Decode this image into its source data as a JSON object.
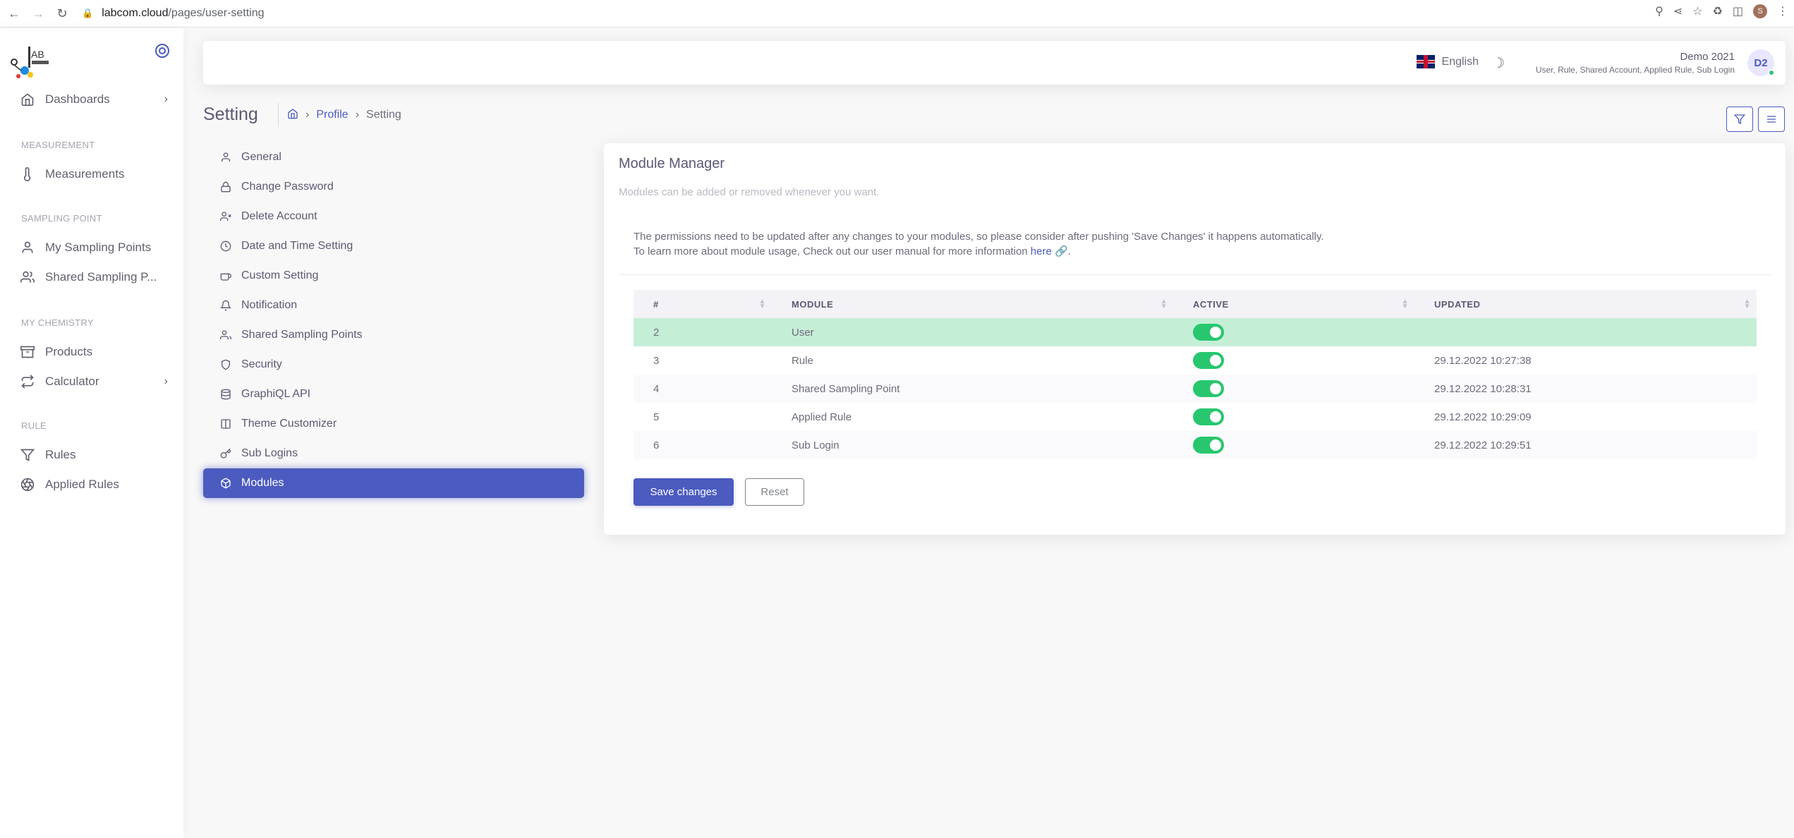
{
  "browser": {
    "url_host": "labcom.cloud",
    "url_path": "/pages/user-setting",
    "profile_initial": "S"
  },
  "sidebar": {
    "items": [
      {
        "label": "Dashboards",
        "icon": "home-icon"
      },
      {
        "header": "MEASUREMENT"
      },
      {
        "label": "Measurements",
        "icon": "thermometer-icon"
      },
      {
        "header": "SAMPLING POINT"
      },
      {
        "label": "My Sampling Points",
        "icon": "user-icon"
      },
      {
        "label": "Shared Sampling P...",
        "icon": "users-icon"
      },
      {
        "header": "MY CHEMISTRY"
      },
      {
        "label": "Products",
        "icon": "package-icon"
      },
      {
        "label": "Calculator",
        "icon": "repeat-icon"
      },
      {
        "header": "RULE"
      },
      {
        "label": "Rules",
        "icon": "filter-icon"
      },
      {
        "label": "Applied Rules",
        "icon": "aperture-icon"
      }
    ]
  },
  "topnav": {
    "language": "English",
    "user_name": "Demo 2021",
    "user_modules": "User, Rule, Shared Account, Applied Rule, Sub Login",
    "avatar_initials": "D2"
  },
  "page": {
    "title": "Setting",
    "breadcrumb": [
      "Profile",
      "Setting"
    ]
  },
  "settings_menu": [
    {
      "label": "General",
      "icon": "user-icon"
    },
    {
      "label": "Change Password",
      "icon": "lock-icon"
    },
    {
      "label": "Delete Account",
      "icon": "user-x-icon"
    },
    {
      "label": "Date and Time Setting",
      "icon": "clock-icon"
    },
    {
      "label": "Custom Setting",
      "icon": "coffee-icon"
    },
    {
      "label": "Notification",
      "icon": "bell-icon"
    },
    {
      "label": "Shared Sampling Points",
      "icon": "users-icon"
    },
    {
      "label": "Security",
      "icon": "shield-icon"
    },
    {
      "label": "GraphiQL API",
      "icon": "database-icon"
    },
    {
      "label": "Theme Customizer",
      "icon": "columns-icon"
    },
    {
      "label": "Sub Logins",
      "icon": "key-icon"
    },
    {
      "label": "Modules",
      "icon": "box-icon",
      "active": true
    }
  ],
  "module_manager": {
    "title": "Module Manager",
    "subtitle": "Modules can be added or removed whenever you want.",
    "info_line1": "The permissions need to be updated after any changes to your modules, so please consider after pushing 'Save Changes' it happens automatically.",
    "info_line2": "To learn more about module usage, Check out our user manual for more information ",
    "info_link": "here",
    "columns": [
      "#",
      "MODULE",
      "ACTIVE",
      "UPDATED"
    ],
    "rows": [
      {
        "id": "2",
        "module": "User",
        "active": true,
        "updated": ""
      },
      {
        "id": "3",
        "module": "Rule",
        "active": true,
        "updated": "29.12.2022 10:27:38"
      },
      {
        "id": "4",
        "module": "Shared Sampling Point",
        "active": true,
        "updated": "29.12.2022 10:28:31"
      },
      {
        "id": "5",
        "module": "Applied Rule",
        "active": true,
        "updated": "29.12.2022 10:29:09"
      },
      {
        "id": "6",
        "module": "Sub Login",
        "active": true,
        "updated": "29.12.2022 10:29:51"
      }
    ],
    "save_label": "Save changes",
    "reset_label": "Reset"
  },
  "colors": {
    "primary": "#4b5bbf",
    "success": "#28c76f",
    "selected_row": "#c5eed7"
  }
}
